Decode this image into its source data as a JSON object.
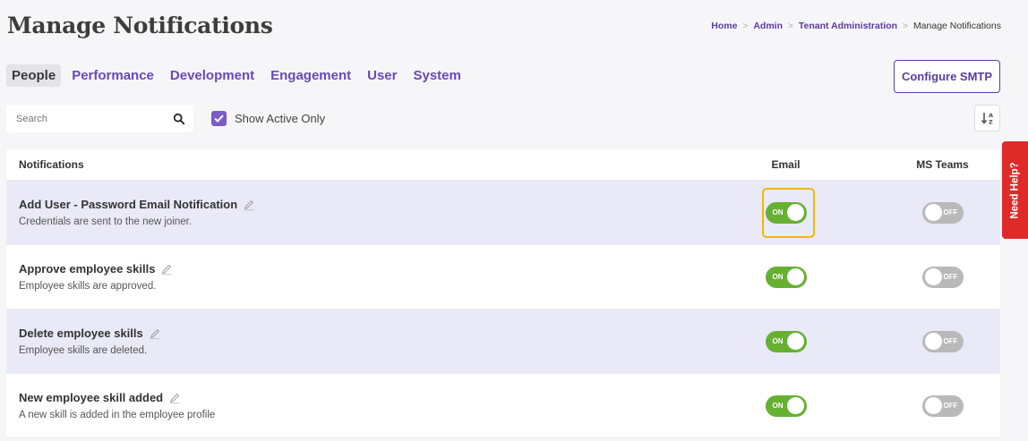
{
  "page": {
    "title": "Manage Notifications"
  },
  "breadcrumb": {
    "items": [
      "Home",
      "Admin",
      "Tenant Administration"
    ],
    "separator": ">",
    "current": "Manage Notifications"
  },
  "tabs": [
    {
      "label": "People",
      "active": true
    },
    {
      "label": "Performance",
      "active": false
    },
    {
      "label": "Development",
      "active": false
    },
    {
      "label": "Engagement",
      "active": false
    },
    {
      "label": "User",
      "active": false
    },
    {
      "label": "System",
      "active": false
    }
  ],
  "toolbar": {
    "configure_smtp_label": "Configure SMTP",
    "search_placeholder": "Search",
    "show_active_label": "Show Active Only",
    "show_active_checked": true
  },
  "table": {
    "headers": {
      "notifications": "Notifications",
      "email": "Email",
      "teams": "MS Teams"
    },
    "rows": [
      {
        "title": "Add User - Password Email Notification",
        "desc": "Credentials are sent to the new joiner.",
        "email": "ON",
        "teams": "OFF"
      },
      {
        "title": "Approve employee skills",
        "desc": "Employee skills are approved.",
        "email": "ON",
        "teams": "OFF"
      },
      {
        "title": "Delete employee skills",
        "desc": "Employee skills are deleted.",
        "email": "ON",
        "teams": "OFF"
      },
      {
        "title": "New employee skill added",
        "desc": "A new skill is added in the employee profile",
        "email": "ON",
        "teams": "OFF"
      }
    ]
  },
  "help": {
    "label": "Need Help?"
  },
  "colors": {
    "accent": "#5b3ba3",
    "toggle_on": "#66b032",
    "toggle_off": "#b9b9b9",
    "highlight": "#f2b705",
    "help": "#e02a2a"
  }
}
